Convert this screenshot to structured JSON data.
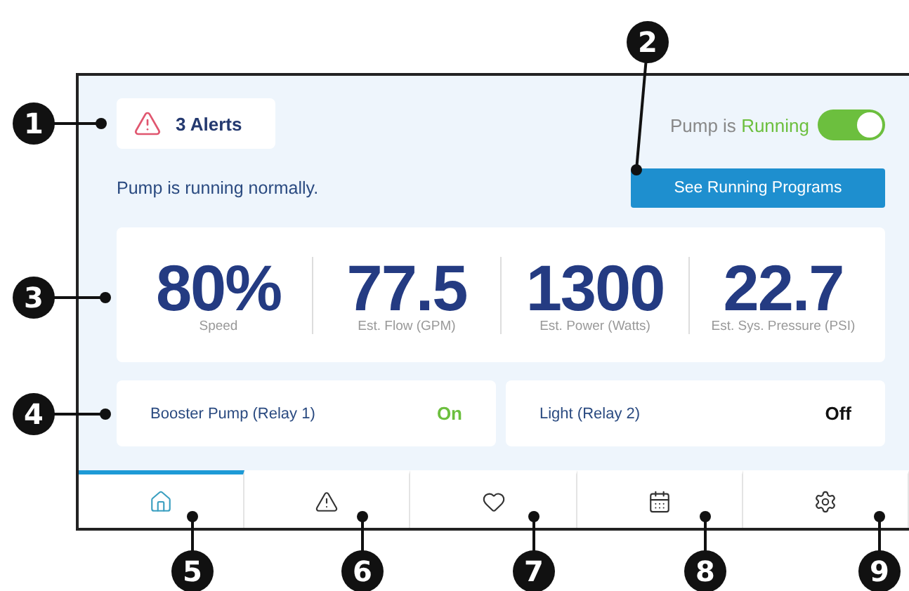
{
  "alerts": {
    "count_label": "3 Alerts"
  },
  "pump_status": {
    "label": "Pump is",
    "value": "Running",
    "on": true
  },
  "message": "Pump is running normally.",
  "programs_button": "See Running Programs",
  "stats": [
    {
      "value": "80%",
      "label": "Speed"
    },
    {
      "value": "77.5",
      "label": "Est. Flow (GPM)"
    },
    {
      "value": "1300",
      "label": "Est. Power (Watts)"
    },
    {
      "value": "22.7",
      "label": "Est. Sys. Pressure (PSI)"
    }
  ],
  "relays": [
    {
      "name": "Booster Pump (Relay 1)",
      "state": "On",
      "on": true
    },
    {
      "name": "Light (Relay 2)",
      "state": "Off",
      "on": false
    }
  ],
  "tabs": [
    {
      "kind": "home",
      "selected": true
    },
    {
      "kind": "alerts",
      "selected": false
    },
    {
      "kind": "favorites",
      "selected": false
    },
    {
      "kind": "schedule",
      "selected": false
    },
    {
      "kind": "settings",
      "selected": false
    }
  ],
  "callouts": [
    "1",
    "2",
    "3",
    "4",
    "5",
    "6",
    "7",
    "8",
    "9"
  ]
}
